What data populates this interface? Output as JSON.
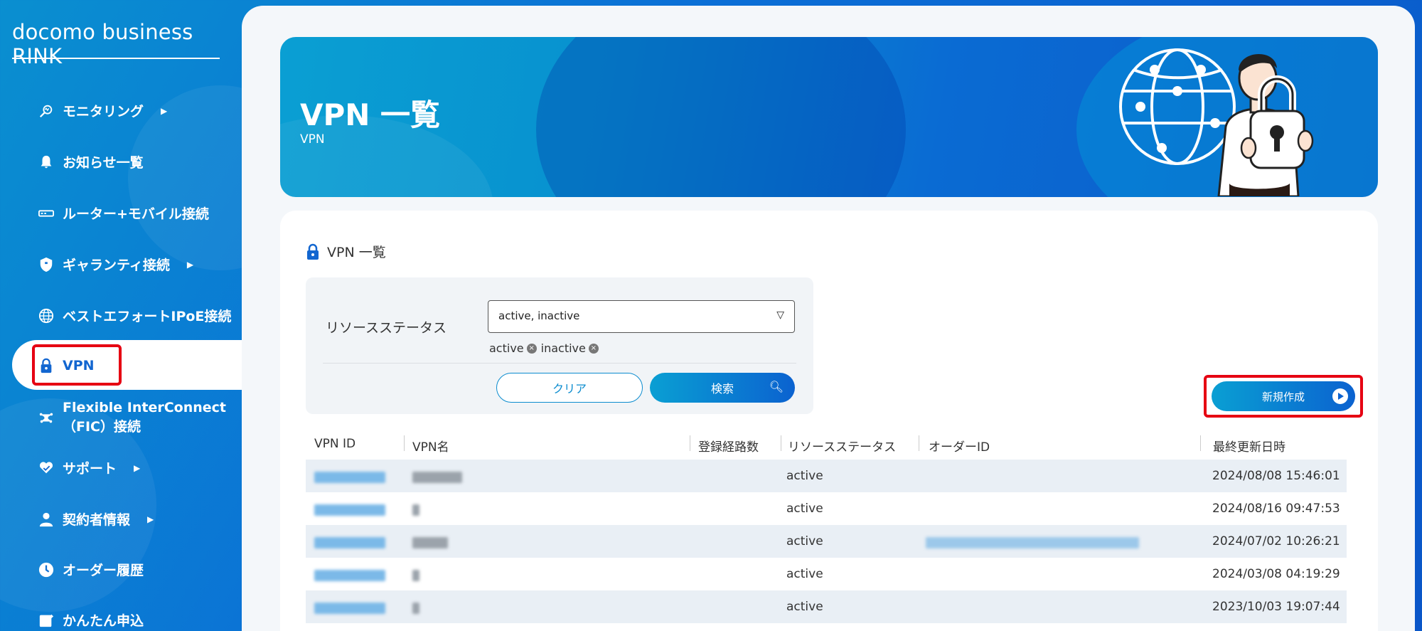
{
  "brand": "docomo business RINK",
  "sidebar": {
    "items": [
      {
        "label": "モニタリング",
        "icon": "monitoring-icon",
        "caret": "▶"
      },
      {
        "label": "お知らせ一覧",
        "icon": "bell-icon"
      },
      {
        "label": "ルーター+モバイル接続",
        "icon": "router-icon"
      },
      {
        "label": "ギャランティ接続",
        "icon": "shield-icon",
        "caret": "▶"
      },
      {
        "label": "ベストエフォートIPoE接続",
        "icon": "globe-icon"
      },
      {
        "label": "VPN",
        "icon": "lock-icon",
        "active": true
      },
      {
        "label": "Flexible InterConnect",
        "label2": "（FIC）接続",
        "icon": "network-icon"
      },
      {
        "label": "サポート",
        "icon": "heart-hand-icon",
        "caret": "▶"
      },
      {
        "label": "契約者情報",
        "icon": "person-icon",
        "caret": "▶"
      },
      {
        "label": "オーダー履歴",
        "icon": "clock-icon"
      },
      {
        "label": "かんたん申込",
        "icon": "edit-icon"
      }
    ]
  },
  "hero": {
    "title": "VPN 一覧",
    "subtitle": "VPN"
  },
  "card": {
    "title": "VPN 一覧"
  },
  "filter": {
    "label": "リソースステータス",
    "select_value": "active, inactive",
    "chips": [
      "active",
      "inactive"
    ],
    "clear_label": "クリア",
    "search_label": "検索"
  },
  "create_label": "新規作成",
  "table": {
    "headers": [
      "VPN ID",
      "VPN名",
      "登録経路数",
      "リソースステータス",
      "オーダーID",
      "最終更新日時"
    ],
    "rows": [
      {
        "status": "active",
        "updated": "2024/08/08 15:46:01",
        "has_order": false
      },
      {
        "status": "active",
        "updated": "2024/08/16 09:47:53",
        "has_order": false
      },
      {
        "status": "active",
        "updated": "2024/07/02 10:26:21",
        "has_order": true
      },
      {
        "status": "active",
        "updated": "2024/03/08 04:19:29",
        "has_order": false
      },
      {
        "status": "active",
        "updated": "2023/10/03 19:07:44",
        "has_order": false
      }
    ]
  },
  "colors": {
    "accent": "#1266d0",
    "highlight": "#e60012"
  }
}
